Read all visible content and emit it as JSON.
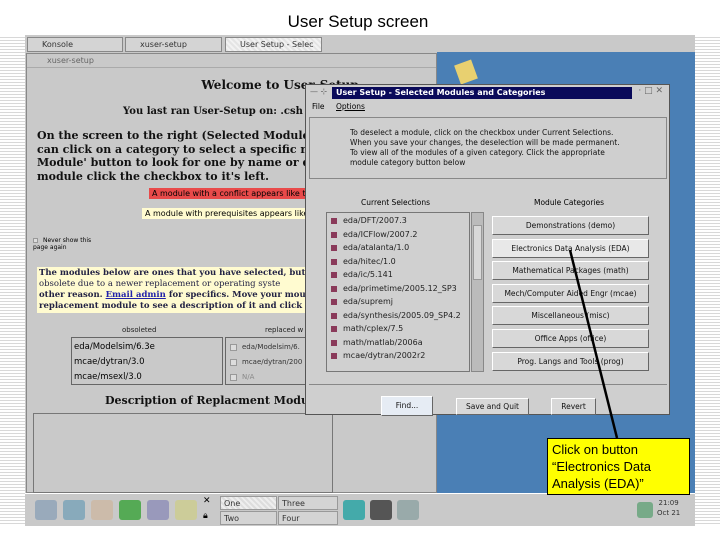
{
  "slide_title": "User Setup screen",
  "taskbar_top": {
    "tabs": [
      {
        "label": "Konsole"
      },
      {
        "label": "xuser-setup"
      },
      {
        "label": "User Setup - Selec"
      }
    ]
  },
  "xuser_window": {
    "title": "xuser-setup",
    "welcome": "Welcome to User-Setup",
    "last_run": "You last ran User-Setup on: .csh",
    "instructions": [
      "On the screen to the right (Selected Modules an",
      "can click on a category to select a specific mod",
      "Module' button to look for one by name or desc",
      "module click the checkbox to it's left."
    ],
    "conflict_legend": "A module with a conflict appears like th",
    "prereq_legend": "A module with prerequisites appears like t",
    "never_show": "Never show this page again",
    "obsolete_text": [
      "The modules below are ones that you have selected, but ",
      "obsolete due to a newer replacement or operating syste",
      "other reason.",
      "for specifics. Move your mous",
      "replacement module to see a description of it and click t"
    ],
    "email_admin": "Email admin",
    "obsoleted_header": "obsoleted",
    "replaced_header": "replaced w",
    "obsoleted": [
      "eda/Modelsim/6.3e",
      "mcae/dytran/3.0",
      "mcae/msexl/3.0"
    ],
    "replaced": [
      "eda/Modelsim/6.",
      "mcae/dytran/200",
      "N/A"
    ],
    "description_heading": "Description of Replacment Module"
  },
  "dialog": {
    "title": "User Setup - Selected Modules and Categories",
    "menu": [
      "File",
      "Options"
    ],
    "info": [
      "To deselect a module, click on the checkbox under Current Selections.",
      "When you save your changes, the deselection will be made permanent.",
      "To view all of the modules of a given category. Click the appropriate",
      "module category button below"
    ],
    "current_header": "Current Selections",
    "categories_header": "Module Categories",
    "selections": [
      "eda/DFT/2007.3",
      "eda/ICFlow/2007.2",
      "eda/atalanta/1.0",
      "eda/hitec/1.0",
      "eda/ic/5.141",
      "eda/primetime/2005.12_SP3",
      "eda/supremj",
      "eda/synthesis/2005.09_SP4.2",
      "math/cplex/7.5",
      "math/matlab/2006a",
      "mcae/dytran/2002r2"
    ],
    "categories": [
      "Demonstrations (demo)",
      "Electronics Data Analysis (EDA)",
      "Mathematical Packages (math)",
      "Mech/Computer Aided Engr (mcae)",
      "Miscellaneous (misc)",
      "Office Apps (office)",
      "Prog. Langs and Tools (prog)"
    ],
    "buttons": {
      "find": "Find...",
      "save": "Save and Quit",
      "revert": "Revert"
    }
  },
  "taskbar": {
    "pager": [
      "One",
      "Three",
      "Two",
      "Four"
    ],
    "clock_time": "21:09",
    "clock_date": "Oct 21"
  },
  "callout": {
    "line1": "Click on button",
    "line2": "“Electronics Data",
    "line3": "Analysis (EDA)”"
  },
  "colors": {
    "desktop": "#4a7fb5",
    "conflict": "#e84a4a",
    "prereq": "#fffbd0",
    "callout": "#ffff00"
  }
}
